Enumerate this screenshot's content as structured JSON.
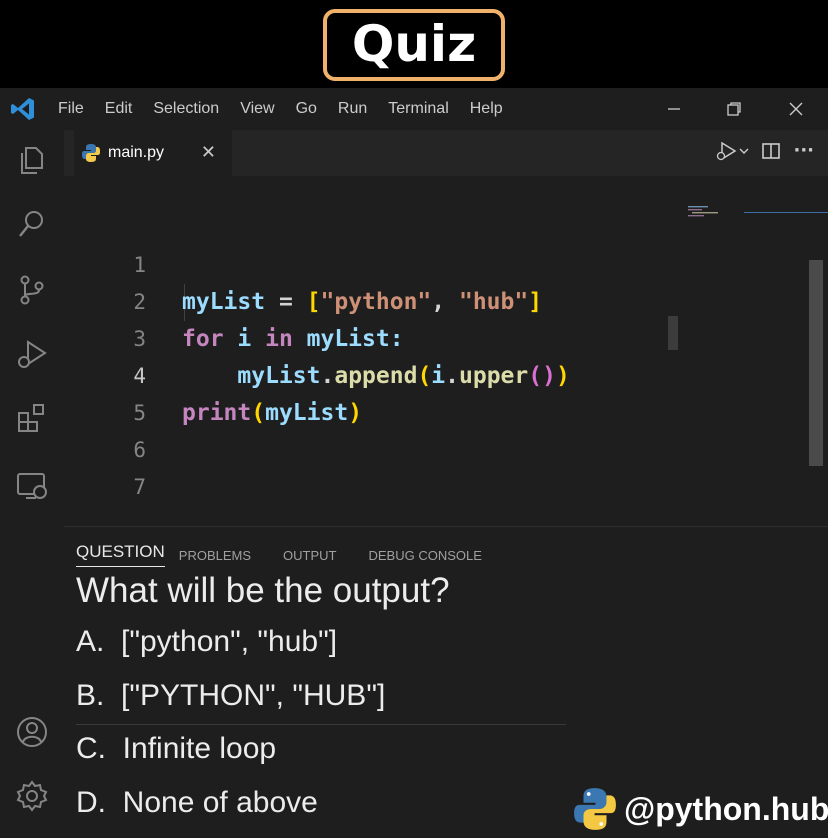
{
  "banner": {
    "title": "Quiz"
  },
  "menu": {
    "items": [
      "File",
      "Edit",
      "Selection",
      "View",
      "Go",
      "Run",
      "Terminal",
      "Help"
    ]
  },
  "window_controls": {
    "minimize": "─",
    "restore": "⧉",
    "close": "✕"
  },
  "activity_bar": {
    "icons": [
      "explorer-icon",
      "search-icon",
      "source-control-icon",
      "run-debug-icon",
      "extensions-icon",
      "remote-explorer-icon",
      "account-icon",
      "settings-gear-icon"
    ]
  },
  "editor": {
    "tab": {
      "label": "main.py",
      "close": "✕"
    },
    "line_numbers": [
      "1",
      "2",
      "3",
      "4",
      "5",
      "6",
      "7"
    ],
    "active_line": "4",
    "code": {
      "line1": {
        "var": "myList",
        "eq": " = ",
        "lb": "[",
        "s1": "\"python\"",
        "comma": ", ",
        "s2": "\"hub\"",
        "rb": "]"
      },
      "line2": {
        "kw1": "for",
        "sp1": " i ",
        "kw2": "in",
        "rest": " myList:"
      },
      "line3": {
        "indent": "    ",
        "obj": "myList",
        "dot": ".",
        "fn": "append",
        "lp": "(",
        "arg": "i",
        "dot2": ".",
        "fn2": "upper",
        "lp2": "(",
        "rp2": ")",
        "rp": ")"
      },
      "line4": {
        "fn": "print",
        "lp": "(",
        "arg": "myList",
        "rp": ")"
      }
    },
    "actions_menu": "···"
  },
  "panel": {
    "tabs": [
      "QUESTION",
      "PROBLEMS",
      "OUTPUT",
      "DEBUG CONSOLE"
    ],
    "active_tab": "QUESTION",
    "question": "What will be the output?",
    "options": [
      "A.  [\"python\", \"hub\"]",
      "B.  [\"PYTHON\", \"HUB\"]",
      "C.  Infinite loop",
      "D.  None of above"
    ]
  },
  "brand": {
    "handle": "@python.hub"
  },
  "colors": {
    "badge_border": "#f0b26a",
    "keyword": "#c586c0",
    "variable": "#9cdcfe",
    "string": "#ce9178",
    "function": "#dcdcaa",
    "bracket_gold": "#ffd700",
    "bracket_purple": "#da70d6"
  }
}
